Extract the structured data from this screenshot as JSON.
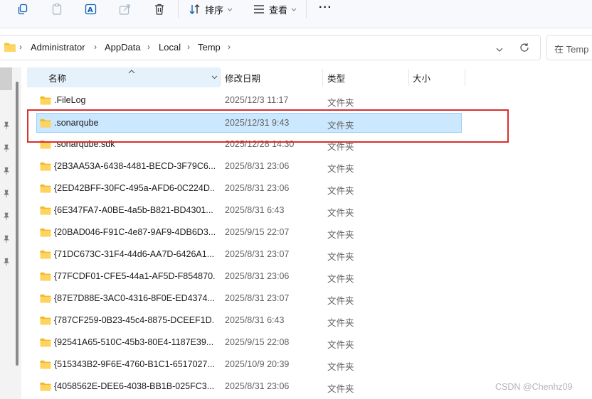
{
  "toolbar": {
    "sort_label": "排序",
    "view_label": "查看",
    "more_label": "···"
  },
  "address": {
    "crumbs": [
      "Administrator",
      "AppData",
      "Local",
      "Temp"
    ],
    "search_placeholder": "在 Temp 中搜索"
  },
  "columns": {
    "name": "名称",
    "modified": "修改日期",
    "type": "类型",
    "size": "大小"
  },
  "rows": [
    {
      "name": ".FileLog",
      "date": "2025/12/3 11:17",
      "type": "文件夹"
    },
    {
      "name": ".sonarqube",
      "date": "2025/12/31 9:43",
      "type": "文件夹"
    },
    {
      "name": ".sonarqube.sdk",
      "date": "2025/12/28 14:30",
      "type": "文件夹"
    },
    {
      "name": "{2B3AA53A-6438-4481-BECD-3F79C6...",
      "date": "2025/8/31 23:06",
      "type": "文件夹"
    },
    {
      "name": "{2ED42BFF-30FC-495a-AFD6-0C224D...",
      "date": "2025/8/31 23:06",
      "type": "文件夹"
    },
    {
      "name": "{6E347FA7-A0BE-4a5b-B821-BD4301...",
      "date": "2025/8/31 6:43",
      "type": "文件夹"
    },
    {
      "name": "{20BAD046-F91C-4e87-9AF9-4DB6D3...",
      "date": "2025/9/15 22:07",
      "type": "文件夹"
    },
    {
      "name": "{71DC673C-31F4-44d6-AA7D-6426A1...",
      "date": "2025/8/31 23:07",
      "type": "文件夹"
    },
    {
      "name": "{77FCDF01-CFE5-44a1-AF5D-F854870...",
      "date": "2025/8/31 23:06",
      "type": "文件夹"
    },
    {
      "name": "{87E7D88E-3AC0-4316-8F0E-ED4374...",
      "date": "2025/8/31 23:07",
      "type": "文件夹"
    },
    {
      "name": "{787CF259-0B23-45c4-8875-DCEEF1D...",
      "date": "2025/8/31 6:43",
      "type": "文件夹"
    },
    {
      "name": "{92541A65-510C-45b3-80E4-1187E39...",
      "date": "2025/9/15 22:08",
      "type": "文件夹"
    },
    {
      "name": "{515343B2-9F6E-4760-B1C1-6517027...",
      "date": "2025/10/9 20:39",
      "type": "文件夹"
    },
    {
      "name": "{4058562E-DEE6-4038-BB1B-025FC3...",
      "date": "2025/8/31 23:06",
      "type": "文件夹"
    }
  ],
  "watermark": "CSDN @Chenhz09",
  "colors": {
    "accent": "#0067c0",
    "selection": "#cce8ff",
    "highlight_box": "#d9302b",
    "folder": "#f5c542"
  }
}
